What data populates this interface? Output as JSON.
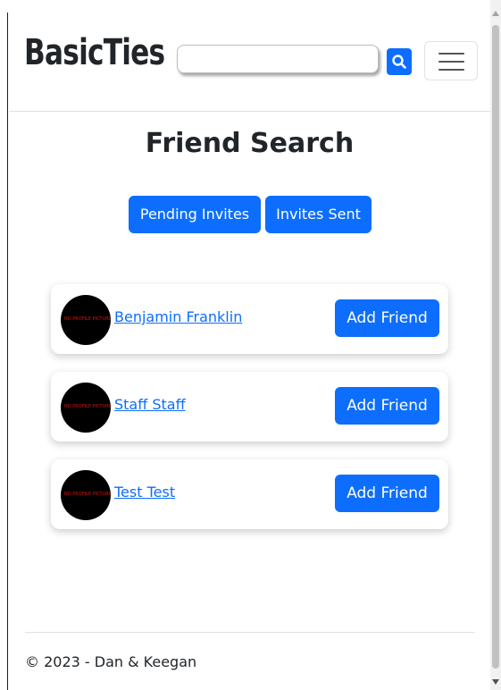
{
  "navbar": {
    "brand": "BasicTies",
    "search_value": "",
    "search_icon": "search-icon",
    "menu_icon": "hamburger-menu-icon"
  },
  "main": {
    "title": "Friend Search",
    "pending_invites_label": "Pending Invites",
    "invites_sent_label": "Invites Sent",
    "friends": [
      {
        "name": "Benjamin Franklin",
        "avatar_text": "NO PROFILE PICTURE",
        "action_label": "Add Friend"
      },
      {
        "name": "Staff Staff",
        "avatar_text": "NO PROFILE PICTURE",
        "action_label": "Add Friend"
      },
      {
        "name": "Test Test",
        "avatar_text": "NO PROFILE PICTURE",
        "action_label": "Add Friend"
      }
    ]
  },
  "footer": {
    "text": "© 2023 - Dan & Keegan"
  },
  "colors": {
    "primary": "#0d6efd",
    "text": "#212529",
    "border": "#dee2e6"
  }
}
